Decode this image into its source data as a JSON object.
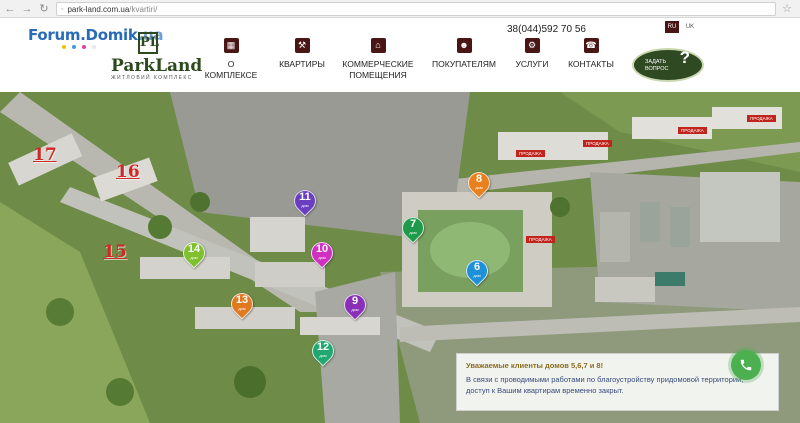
{
  "browser": {
    "url": "park-land.com.ua",
    "url_path": "/kvartiri/"
  },
  "header": {
    "forum_logo": "Forum.Domik",
    "forum_logo_suffix": ".ua",
    "brand_name": "ParkLand",
    "brand_mark": "PL",
    "brand_subtitle": "ЖИТЛОВИЙ КОМПЛЕКС",
    "phone": "38(044)592 70 56",
    "languages": [
      "RU",
      "UK"
    ],
    "active_language": "RU",
    "nav": [
      {
        "label": "О КОМПЛЕКСЕ",
        "icon": "building-icon"
      },
      {
        "label": "КВАРТИРЫ",
        "icon": "hammer-icon"
      },
      {
        "label": "КОММЕРЧЕСКИЕ ПОМЕЩЕНИЯ",
        "icon": "storefront-icon"
      },
      {
        "label": "ПОКУПАТЕЛЯМ",
        "icon": "people-icon"
      },
      {
        "label": "УСЛУГИ",
        "icon": "wrench-icon"
      },
      {
        "label": "КОНТАКТЫ",
        "icon": "phone-icon"
      }
    ],
    "ask_button": "ЗАДАТЬ ВОПРОС",
    "ask_mark": "?"
  },
  "map": {
    "houses": [
      {
        "num": "11",
        "label": "дом",
        "color": "#6a3fbf"
      },
      {
        "num": "10",
        "label": "дом",
        "color": "#d030c0"
      },
      {
        "num": "14",
        "label": "дом",
        "color": "#7fc02e"
      },
      {
        "num": "13",
        "label": "дом",
        "color": "#e07a20"
      },
      {
        "num": "9",
        "label": "дом",
        "color": "#8a30b8"
      },
      {
        "num": "12",
        "label": "дом",
        "color": "#20a870"
      },
      {
        "num": "8",
        "label": "дом",
        "color": "#e8801e"
      },
      {
        "num": "7",
        "label": "дом",
        "color": "#1f9a4a"
      },
      {
        "num": "6",
        "label": "дом",
        "color": "#1e90d8"
      }
    ],
    "red_labels": [
      "17",
      "16",
      "15"
    ],
    "sale_tag": "ПРОДАЖА"
  },
  "notice": {
    "title": "Уважаемые клиенты домов 5,6,7 и 8!",
    "body": "В связи с проводимыми работами по благоустройству придомовой территории, доступ к Вашим квартирам временно закрыт."
  },
  "colors": {
    "brand_dark": "#4a1515",
    "brand_green": "#2d4a1e",
    "call_green": "#4caf50"
  }
}
